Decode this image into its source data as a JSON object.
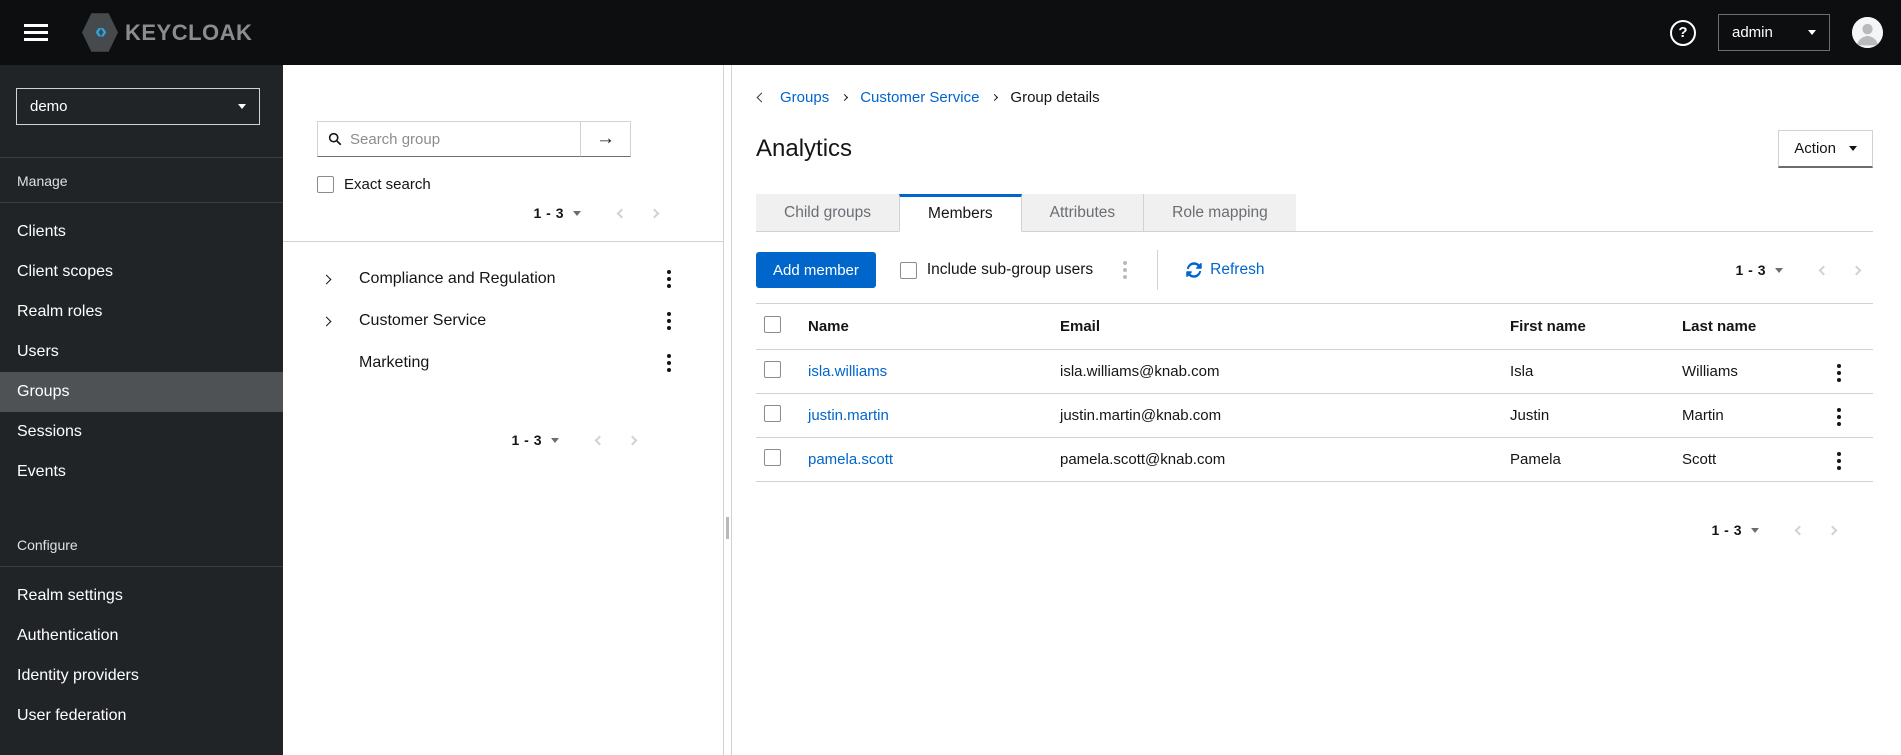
{
  "colors": {
    "accent": "#0066cc",
    "masthead_bg": "#0c0e10",
    "sidebar_bg": "#212427",
    "sidebar_selected_bg": "#4f5255",
    "link": "#0066cc",
    "logo_icon_cyan": "#26a9e0",
    "logo_text_gray": "#8a8d90",
    "tab_inactive_bg": "#f0f0f0",
    "border_light": "#d2d2d2"
  },
  "icons": {
    "arrow_right": "→",
    "help": "?",
    "logo_left_angle": "‹",
    "logo_right_angle": "›"
  },
  "masthead": {
    "brand_text": "KEYCLOAK",
    "user_menu_label": "admin"
  },
  "sidebar": {
    "realm": "demo",
    "sections": [
      {
        "label": "Manage",
        "selected_item": "Groups",
        "items": [
          "Clients",
          "Client scopes",
          "Realm roles",
          "Users",
          "Groups",
          "Sessions",
          "Events"
        ]
      },
      {
        "label": "Configure",
        "items": [
          "Realm settings",
          "Authentication",
          "Identity providers",
          "User federation"
        ]
      }
    ]
  },
  "groups_panel": {
    "search_placeholder": "Search group",
    "exact_search_label": "Exact search",
    "pagination_top": {
      "range": "1 - 3"
    },
    "pagination_bottom": {
      "range": "1 - 3"
    },
    "tree": [
      {
        "label": "Compliance and Regulation",
        "expandable": true
      },
      {
        "label": "Customer Service",
        "expandable": true
      },
      {
        "label": "Marketing",
        "expandable": false
      }
    ]
  },
  "content": {
    "breadcrumb": {
      "items": [
        "Groups",
        "Customer Service",
        "Group details"
      ]
    },
    "title": "Analytics",
    "action_button_label": "Action",
    "tabs": [
      {
        "label": "Child groups",
        "active": false
      },
      {
        "label": "Members",
        "active": true
      },
      {
        "label": "Attributes",
        "active": false
      },
      {
        "label": "Role mapping",
        "active": false
      }
    ],
    "toolbar": {
      "add_member_label": "Add member",
      "include_subgroups_label": "Include sub-group users",
      "refresh_label": "Refresh",
      "pagination": {
        "range": "1 - 3"
      }
    },
    "members_table": {
      "headers": [
        "Name",
        "Email",
        "First name",
        "Last name"
      ],
      "rows": [
        {
          "name": "isla.williams",
          "email": "isla.williams@knab.com",
          "first_name": "Isla",
          "last_name": "Williams"
        },
        {
          "name": "justin.martin",
          "email": "justin.martin@knab.com",
          "first_name": "Justin",
          "last_name": "Martin"
        },
        {
          "name": "pamela.scott",
          "email": "pamela.scott@knab.com",
          "first_name": "Pamela",
          "last_name": "Scott"
        }
      ]
    },
    "pagination_bottom": {
      "range": "1 - 3"
    }
  }
}
